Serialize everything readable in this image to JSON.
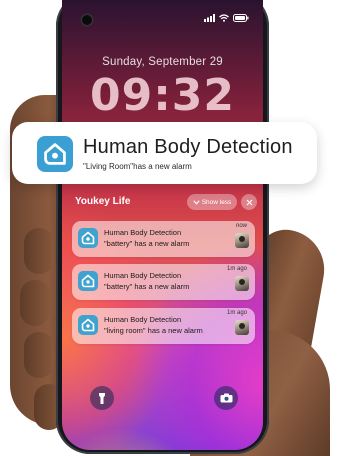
{
  "lock_screen": {
    "date": "Sunday, September 29",
    "time": "09:32"
  },
  "banner": {
    "title": "Human Body Detection",
    "body": "\"Living Room\"has a new alarm",
    "icon": "home-detection-icon"
  },
  "notification_group": {
    "app_name": "Youkey Life",
    "show_less_label": "Show less"
  },
  "notifications": [
    {
      "title": "Human Body Detection",
      "body": "\"battery\" has a new alarm",
      "time": "now"
    },
    {
      "title": "Human Body Detection",
      "body": "\"battery\" has a new alarm",
      "time": "1m ago"
    },
    {
      "title": "Human Body Detection",
      "body": "\"living room\" has a new alarm",
      "time": "1m ago"
    }
  ],
  "quick_actions": {
    "left_icon": "flashlight-icon",
    "right_icon": "camera-icon"
  },
  "colors": {
    "app_icon": "#3aa0d3",
    "banner_bg": "#ffffff"
  }
}
